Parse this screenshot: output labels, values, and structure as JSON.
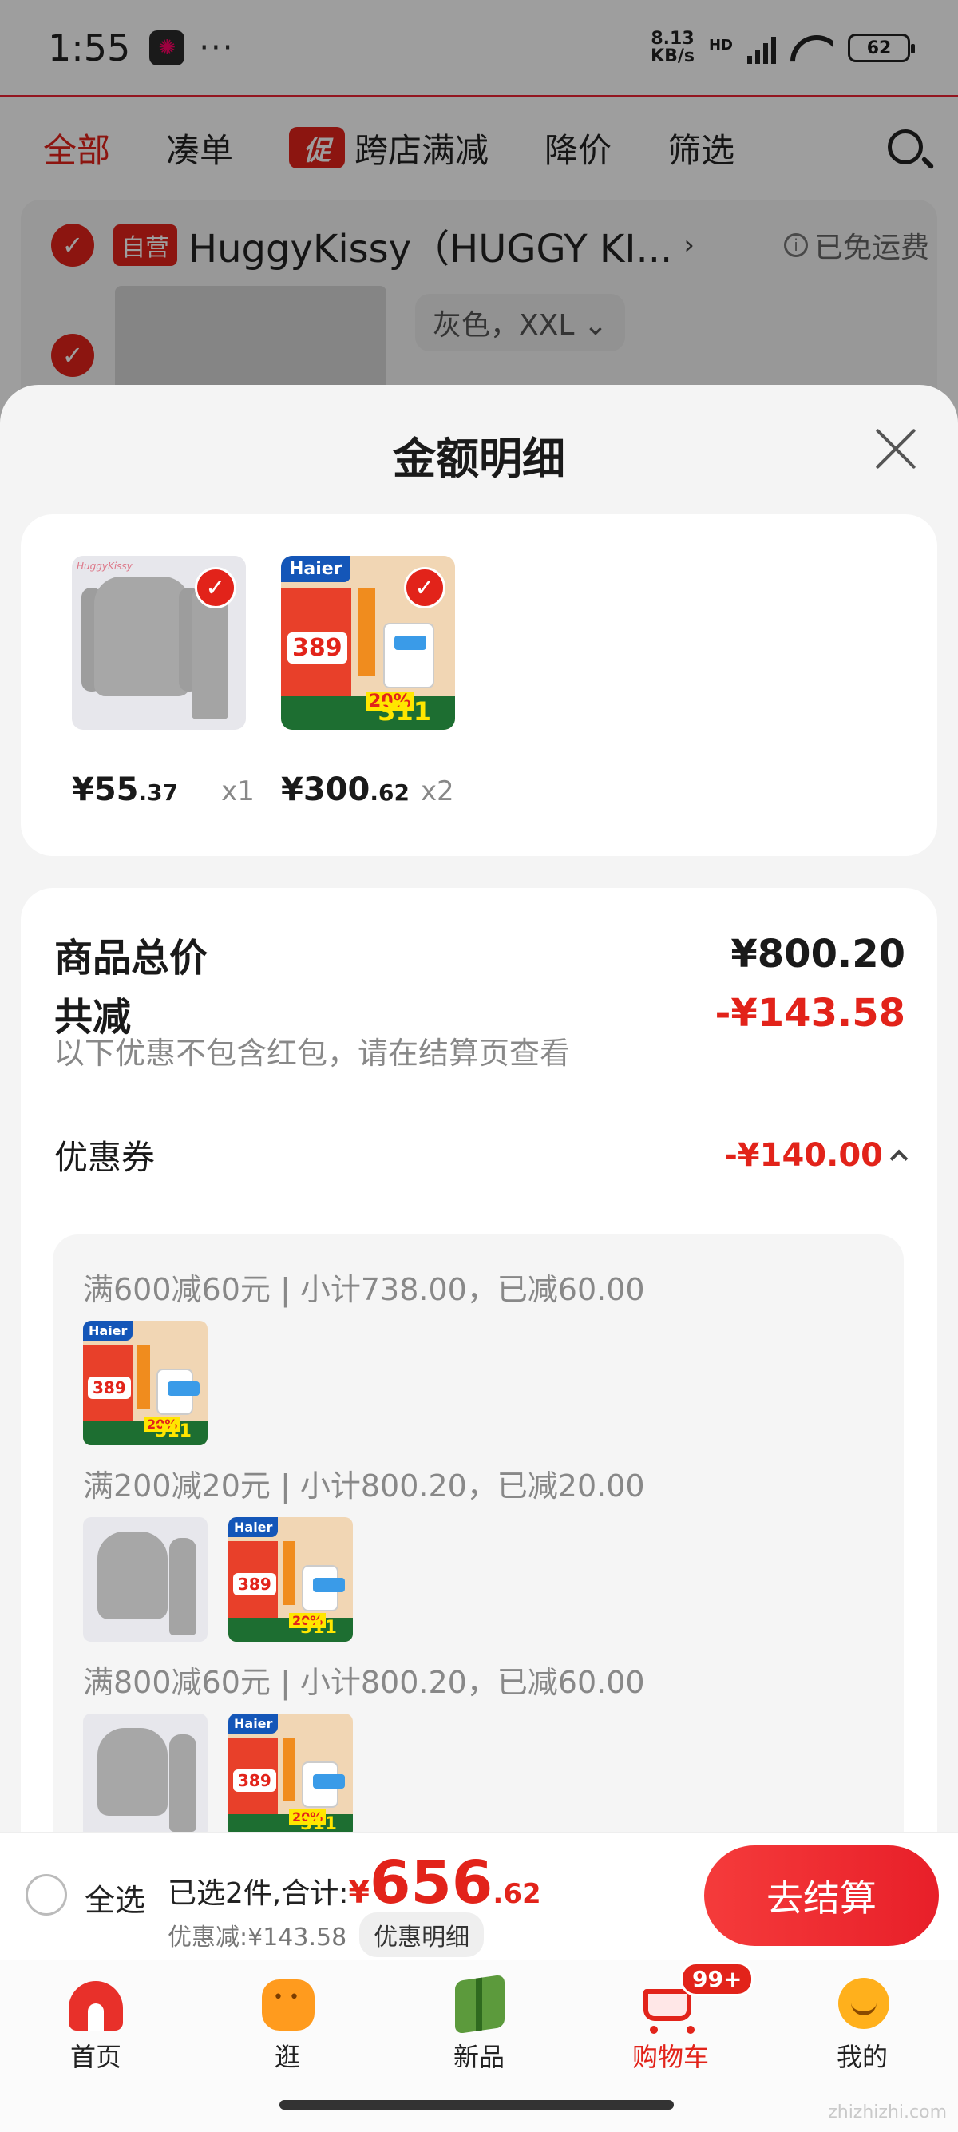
{
  "status_bar": {
    "time": "1:55",
    "dots": "···",
    "net_speed_top": "8.13",
    "net_speed_bottom": "KB/s",
    "network": "HD",
    "battery": "62"
  },
  "filter_tabs": {
    "all": "全部",
    "bundle": "凑单",
    "promo_badge": "促",
    "cross_store": "跨店满减",
    "price_drop": "降价",
    "filter": "筛选"
  },
  "store": {
    "badge": "自营",
    "name": "HuggyKissy（HUGGY KI...",
    "shipping": "已免运费",
    "variant": "灰色，XXL"
  },
  "sheet": {
    "title": "金额明细",
    "items": [
      {
        "image": "thermal-underwear-set",
        "price_int": "¥55",
        "price_dec": ".37",
        "qty": "x1",
        "brand_mark": "HuggyKissy"
      },
      {
        "image": "haier-water-heater",
        "price_int": "¥300",
        "price_dec": ".62",
        "qty": "x2",
        "brand_mark": "Haier",
        "promo_price": "389",
        "promo_number": "311",
        "promo_pct": "20%"
      }
    ],
    "total_label": "商品总价",
    "total_value": "¥800.20",
    "discount_label": "共减",
    "discount_value": "-¥143.58",
    "discount_note": "以下优惠不包含红包，请在结算页查看",
    "coupon_label": "优惠券",
    "coupon_value": "-¥140.00",
    "coupon_rules": [
      {
        "text": "满600减60元 | 小计738.00，已减60.00"
      },
      {
        "text": "满200减20元 | 小计800.20，已减20.00"
      },
      {
        "text": "满800减60元 | 小计800.20，已减60.00"
      }
    ]
  },
  "checkout": {
    "select_all": "全选",
    "selected_text": "已选2件,合计:",
    "total_yen": "¥",
    "total_int": "656",
    "total_dec": ".62",
    "saved_text": "优惠减:¥143.58",
    "detail_button": "优惠明细",
    "checkout_button": "去结算"
  },
  "bottom_nav": {
    "home": "首页",
    "stroll": "逛",
    "new": "新品",
    "cart": "购物车",
    "cart_badge": "99+",
    "mine": "我的"
  },
  "watermark": "zhizhizhi.com",
  "colors": {
    "accent": "#e2231a",
    "background": "#f4f4f4"
  }
}
